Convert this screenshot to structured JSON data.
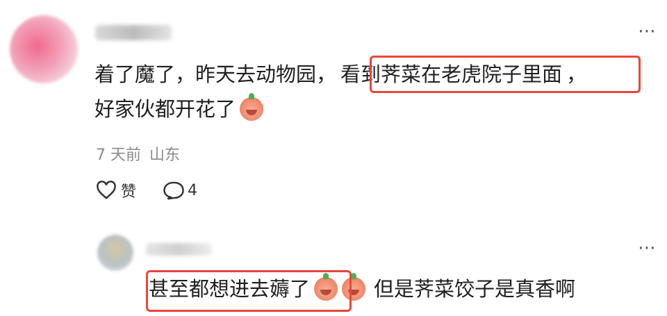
{
  "comment": {
    "text_line1_part1": "着了魔了，昨天去动物园，",
    "text_line1_highlight": "看到荠菜在老虎院子里面",
    "text_line1_part2": "，",
    "text_line2": "好家伙都开花了",
    "emoji_icon": "crying-peach-emoji",
    "time": "7 天前",
    "location": "山东",
    "like_label": "赞",
    "comment_count": "4",
    "highlight_color": "#e8463a"
  },
  "reply": {
    "highlight": "甚至都想进去薅了",
    "text_tail": "但是荠菜饺子是真香啊",
    "emoji_icon": "peach-emoji"
  },
  "more_glyph": "⋯"
}
